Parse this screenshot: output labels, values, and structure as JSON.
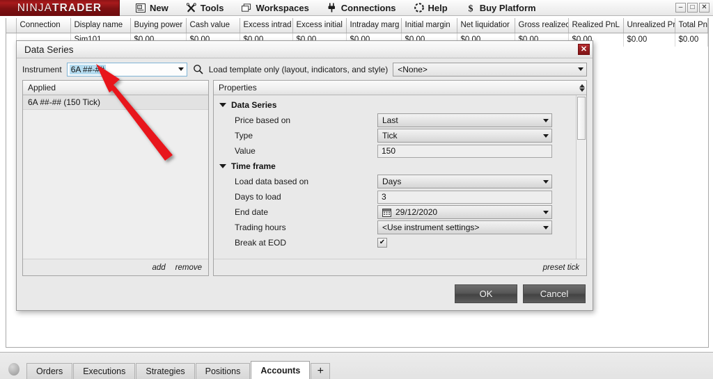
{
  "app": {
    "logo_part_a": "NINJA",
    "logo_part_b": "TRADER"
  },
  "menu": {
    "items": [
      {
        "label": "New",
        "icon": "new-window-icon"
      },
      {
        "label": "Tools",
        "icon": "tools-icon"
      },
      {
        "label": "Workspaces",
        "icon": "workspaces-icon"
      },
      {
        "label": "Connections",
        "icon": "plug-icon"
      },
      {
        "label": "Help",
        "icon": "help-icon"
      },
      {
        "label": "Buy Platform",
        "icon": "dollar-icon"
      }
    ],
    "window_controls": {
      "minimize": "–",
      "maximize": "□",
      "close": "✕"
    }
  },
  "accounts_table": {
    "columns": [
      "Connection",
      "Display name",
      "Buying power",
      "Cash value",
      "Excess intrad",
      "Excess initial",
      "Intraday marg",
      "Initial margin",
      "Net liquidatior",
      "Gross realizec",
      "Realized PnL",
      "Unrealized Pr",
      "Total PnL"
    ],
    "rows": [
      {
        "connection": "",
        "display_name": "Sim101",
        "buying_power": "$0.00",
        "cash_value": "$0.00",
        "excess_intraday": "$0.00",
        "excess_initial": "$0.00",
        "intraday_margin": "$0.00",
        "initial_margin": "$0.00",
        "net_liquidation": "$0.00",
        "gross_realized": "$0.00",
        "realized_pnl": "$0.00",
        "unrealized_pnl": "$0.00",
        "total_pnl": "$0.00"
      }
    ]
  },
  "dialog": {
    "title": "Data Series",
    "close_label": "✕",
    "instrument_label": "Instrument",
    "instrument_value": "6A ##-##",
    "search_icon": "search-icon",
    "template_label": "Load template only (layout, indicators, and style)",
    "template_value": "<None>",
    "applied": {
      "header": "Applied",
      "items": [
        "6A ##-## (150 Tick)"
      ],
      "add_label": "add",
      "remove_label": "remove"
    },
    "properties": {
      "header": "Properties",
      "preset_label": "preset tick",
      "groups": [
        {
          "name": "Data Series",
          "rows": [
            {
              "label": "Price based on",
              "value": "Last",
              "kind": "combo"
            },
            {
              "label": "Type",
              "value": "Tick",
              "kind": "combo"
            },
            {
              "label": "Value",
              "value": "150",
              "kind": "text"
            }
          ]
        },
        {
          "name": "Time frame",
          "rows": [
            {
              "label": "Load data based on",
              "value": "Days",
              "kind": "combo"
            },
            {
              "label": "Days to load",
              "value": "3",
              "kind": "text"
            },
            {
              "label": "End date",
              "value": "29/12/2020",
              "kind": "date"
            },
            {
              "label": "Trading hours",
              "value": "<Use instrument settings>",
              "kind": "combo"
            },
            {
              "label": "Break at EOD",
              "value": "✔",
              "kind": "checkbox"
            }
          ]
        }
      ]
    },
    "ok_label": "OK",
    "cancel_label": "Cancel"
  },
  "tabs": {
    "items": [
      {
        "label": "Orders",
        "active": false
      },
      {
        "label": "Executions",
        "active": false
      },
      {
        "label": "Strategies",
        "active": false
      },
      {
        "label": "Positions",
        "active": false
      },
      {
        "label": "Accounts",
        "active": true
      }
    ],
    "add_label": "+"
  },
  "annotation": {
    "arrow_color": "#e8131a",
    "points_to": "instrument-combo"
  }
}
